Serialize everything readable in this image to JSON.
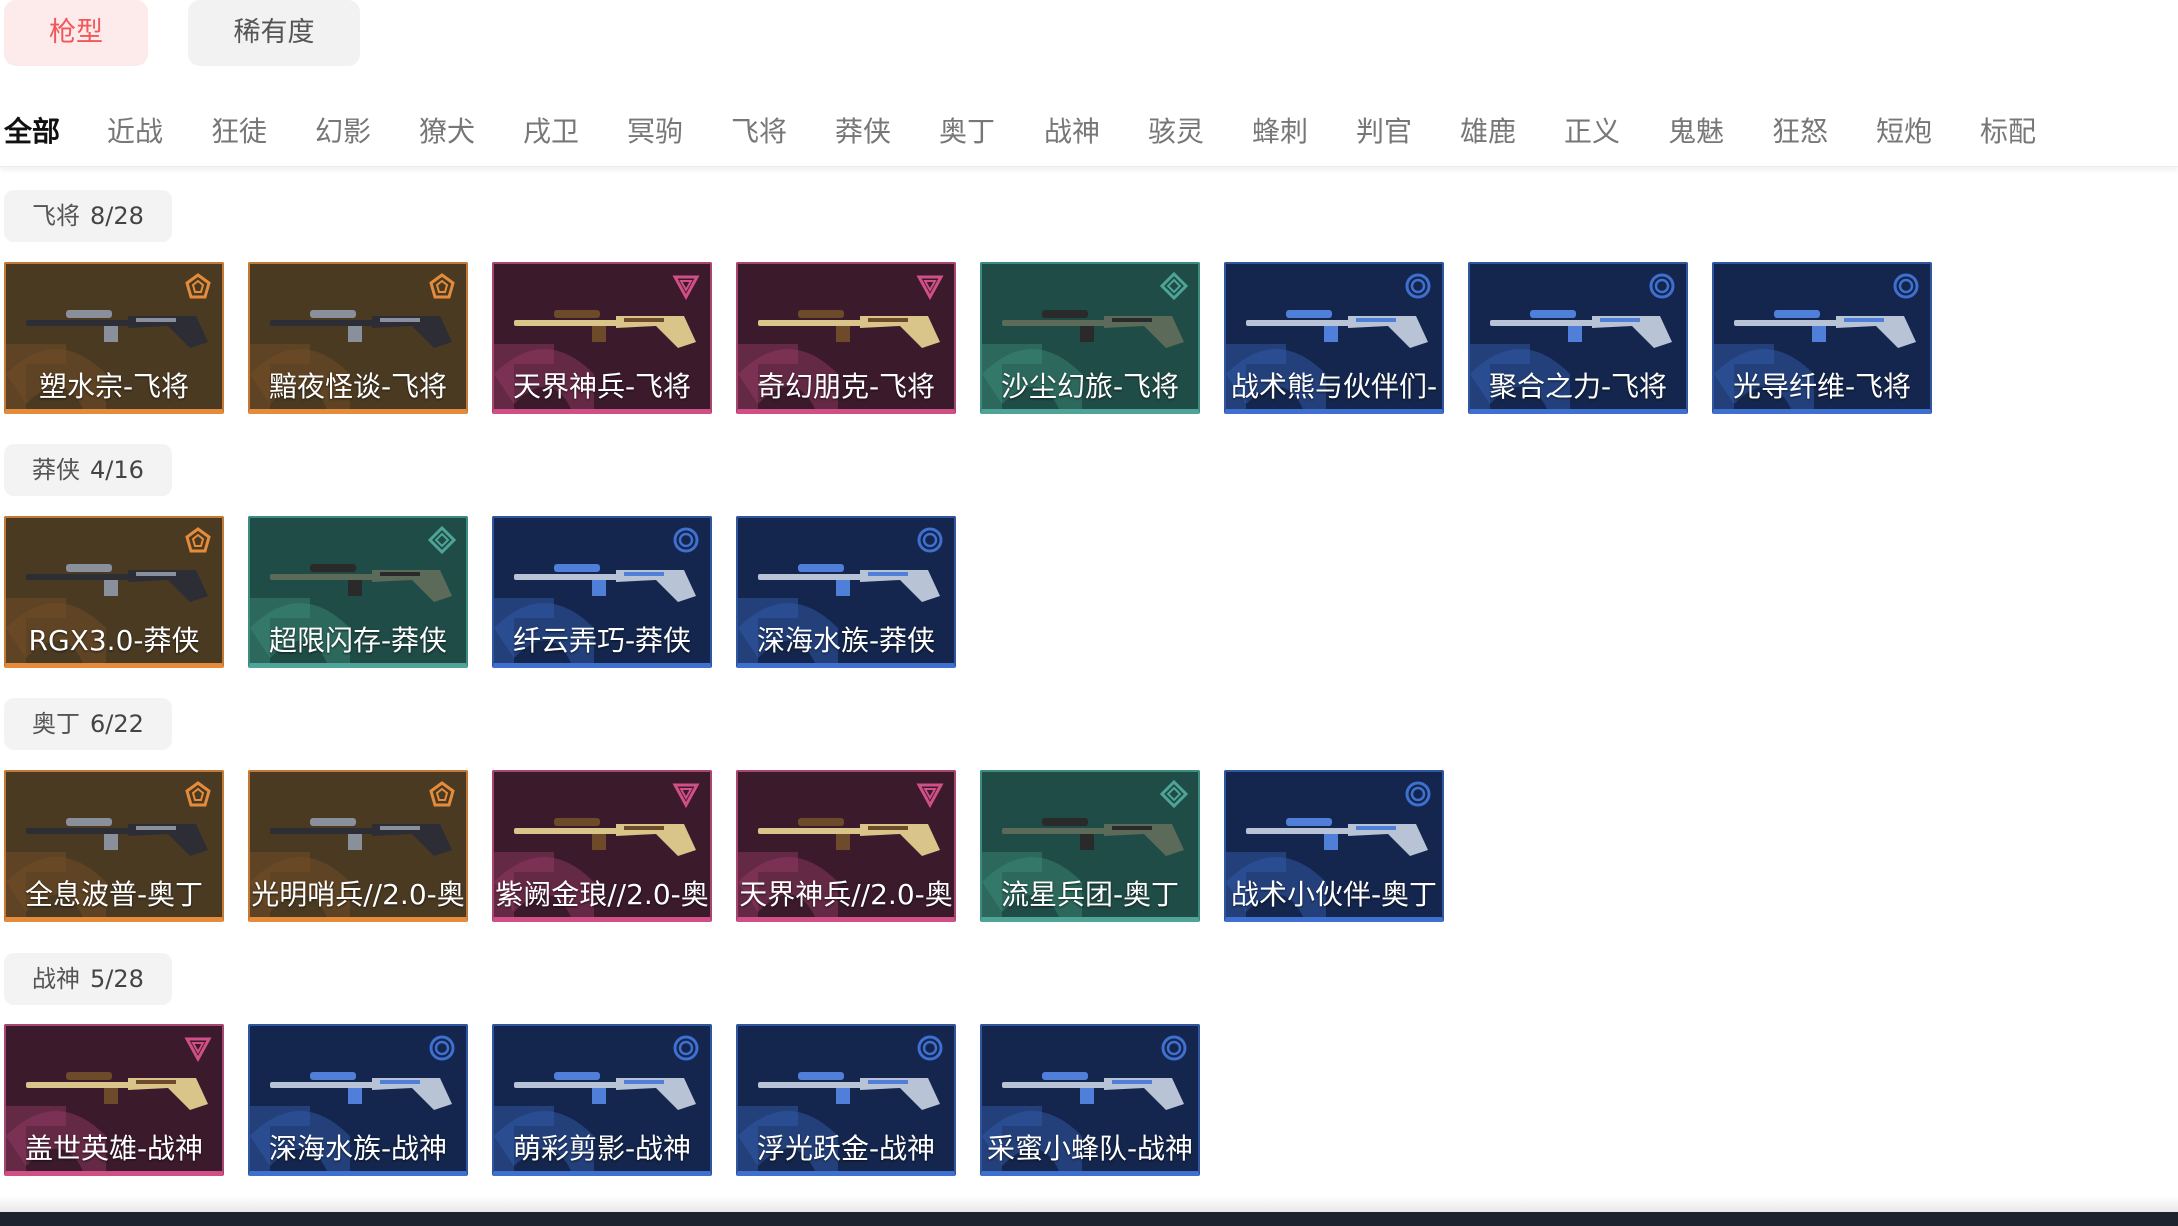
{
  "filters": {
    "gun_type": "枪型",
    "rarity": "稀有度"
  },
  "categories": [
    "全部",
    "近战",
    "狂徒",
    "幻影",
    "獠犬",
    "戌卫",
    "冥驹",
    "飞将",
    "莽侠",
    "奥丁",
    "战神",
    "骇灵",
    "蜂刺",
    "判官",
    "雄鹿",
    "正义",
    "鬼魅",
    "狂怒",
    "短炮",
    "标配"
  ],
  "active_category": "全部",
  "groups": [
    {
      "name": "飞将",
      "count": "8/28",
      "items": [
        {
          "name": "塑水宗-飞将",
          "tier": "orange"
        },
        {
          "name": "黯夜怪谈-飞将",
          "tier": "orange"
        },
        {
          "name": "天界神兵-飞将",
          "tier": "pink"
        },
        {
          "name": "奇幻朋克-飞将",
          "tier": "pink"
        },
        {
          "name": "沙尘幻旅-飞将",
          "tier": "green"
        },
        {
          "name": "战术熊与伙伴们-",
          "tier": "blue"
        },
        {
          "name": "聚合之力-飞将",
          "tier": "blue"
        },
        {
          "name": "光导纤维-飞将",
          "tier": "blue"
        }
      ]
    },
    {
      "name": "莽侠",
      "count": "4/16",
      "items": [
        {
          "name": "RGX3.0-莽侠",
          "tier": "orange"
        },
        {
          "name": "超限闪存-莽侠",
          "tier": "green"
        },
        {
          "name": "纤云弄巧-莽侠",
          "tier": "blue"
        },
        {
          "name": "深海水族-莽侠",
          "tier": "blue"
        }
      ]
    },
    {
      "name": "奥丁",
      "count": "6/22",
      "items": [
        {
          "name": "全息波普-奥丁",
          "tier": "orange"
        },
        {
          "name": "光明哨兵//2.0-奥",
          "tier": "orange"
        },
        {
          "name": "紫阙金琅//2.0-奥",
          "tier": "pink"
        },
        {
          "name": "天界神兵//2.0-奥",
          "tier": "pink"
        },
        {
          "name": "流星兵团-奥丁",
          "tier": "green"
        },
        {
          "name": "战术小伙伴-奥丁",
          "tier": "blue"
        }
      ]
    },
    {
      "name": "战神",
      "count": "5/28",
      "items": [
        {
          "name": "盖世英雄-战神",
          "tier": "pink"
        },
        {
          "name": "深海水族-战神",
          "tier": "blue"
        },
        {
          "name": "萌彩剪影-战神",
          "tier": "blue"
        },
        {
          "name": "浮光跃金-战神",
          "tier": "blue"
        },
        {
          "name": "采蜜小蜂队-战神",
          "tier": "blue"
        }
      ]
    }
  ],
  "colors": {
    "orange": "#e58c3c",
    "pink": "#d04f86",
    "green": "#4ea597",
    "blue": "#3f6fcf",
    "filter_active_text": "#f2585a",
    "filter_active_bg": "#fdeaea"
  }
}
